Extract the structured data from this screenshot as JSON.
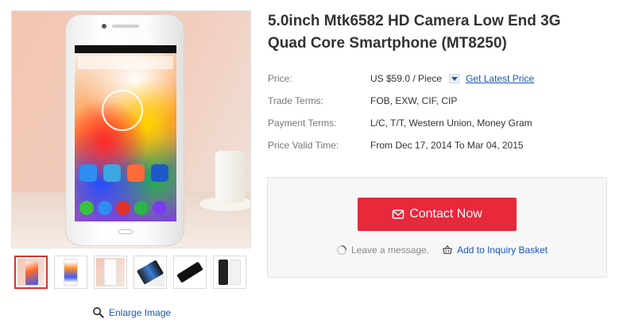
{
  "product": {
    "title": "5.0inch Mtk6582 HD Camera Low End 3G Quad Core Smartphone (MT8250)",
    "main_image_icon": "smartphone-photo"
  },
  "attributes": [
    {
      "label": "Price:",
      "value": "US $59.0 / Piece",
      "link": "Get Latest Price"
    },
    {
      "label": "Trade Terms:",
      "value": "FOB, EXW, CIF, CIP"
    },
    {
      "label": "Payment Terms:",
      "value": "L/C, T/T, Western Union, Money Gram"
    },
    {
      "label": "Price Valid Time:",
      "value": "From Dec 17, 2014 To Mar 04, 2015"
    }
  ],
  "gallery": {
    "thumbnail_count": 6,
    "active_index": 0,
    "enlarge_label": "Enlarge Image"
  },
  "contact": {
    "button_label": "Contact Now",
    "leave_message": "Leave a message.",
    "inquiry_basket": "Add to Inquiry Basket"
  },
  "colors": {
    "accent": "#e8283b",
    "link": "#1a56b8",
    "active_thumb_border": "#e0312a"
  }
}
